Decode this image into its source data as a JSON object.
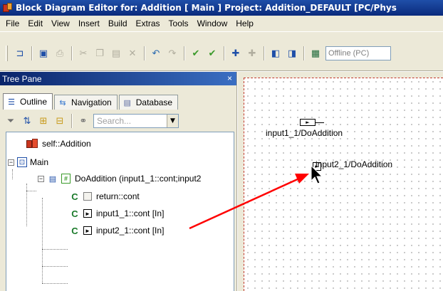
{
  "window": {
    "title": "Block Diagram Editor for: Addition [ Main ] Project: Addition_DEFAULT [PC/Phys"
  },
  "menu": [
    "File",
    "Edit",
    "View",
    "Insert",
    "Build",
    "Extras",
    "Tools",
    "Window",
    "Help"
  ],
  "toolbar": {
    "icons": [
      "select-tool-icon",
      "save-icon",
      "print-icon",
      "cut-icon",
      "copy-icon",
      "paste-icon",
      "delete-icon",
      "undo-icon",
      "redo-icon",
      "check-icon",
      "check-all-icon",
      "add-element-icon",
      "remove-element-icon",
      "import-icon",
      "export-icon",
      "target-icon"
    ],
    "target_dropdown": "Offline (PC)"
  },
  "tree_pane": {
    "title": "Tree Pane",
    "close": "×",
    "tabs": [
      {
        "label": "Outline",
        "icon": "outline-icon"
      },
      {
        "label": "Navigation",
        "icon": "navigation-icon"
      },
      {
        "label": "Database",
        "icon": "database-icon"
      }
    ],
    "search_placeholder": "Search...",
    "items": [
      {
        "label": "self::Addition",
        "icon": "class-icon"
      },
      {
        "label": "Main",
        "icon": "diagram-icon"
      },
      {
        "label": "DoAddition (input1_1::cont;input2",
        "icon": "process-icon"
      },
      {
        "label": "return::cont",
        "icon": "continuous-icon"
      },
      {
        "label": "input1_1::cont [In]",
        "icon": "input-message-icon"
      },
      {
        "label": "input2_1::cont [In]",
        "icon": "input-message-icon"
      }
    ]
  },
  "diagram": {
    "elements": [
      {
        "label": "input1_1/DoAddition"
      },
      {
        "label": "input2_1/DoAddition"
      }
    ],
    "drag_arrow_color": "#ff0000"
  }
}
